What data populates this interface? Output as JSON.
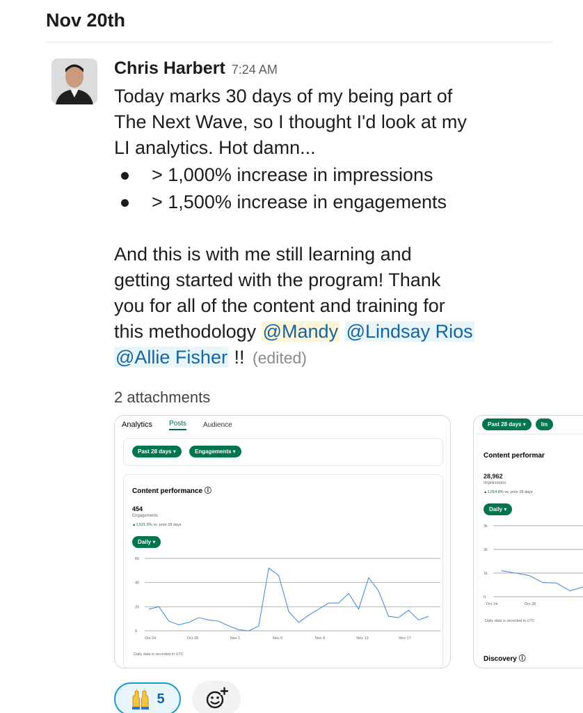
{
  "day_header": "Nov 20th",
  "message": {
    "author": "Chris Harbert",
    "time": "7:24 AM",
    "lines": [
      "Today marks 30 days of my being part of",
      "The Next Wave, so I thought I'd look at my",
      "LI analytics. Hot damn..."
    ],
    "bullets": [
      "> 1,000% increase in impressions",
      "> 1,500% increase in engagements"
    ],
    "para2_lines": [
      "And this is with me still learning and",
      "getting started with the program! Thank",
      "you for all of the content and training for"
    ],
    "last_line_prefix": "this methodology ",
    "mentions": [
      "@Mandy",
      "@Lindsay Rios",
      "@Allie Fisher"
    ],
    "suffix": " !!",
    "edited": "(edited)"
  },
  "attachments_label": "2 attachments",
  "attachment1": {
    "tabs": [
      "Analytics",
      "Posts",
      "Audience"
    ],
    "filters": [
      "Past 28 days ▾",
      "Engagements ▾"
    ],
    "title": "Content performance",
    "info_icon": "ⓘ",
    "value": "454",
    "metric": "Engagements",
    "delta_value": "▲1,521.5%",
    "delta_text": " vs. prior 28 days",
    "daily": "Daily ▾",
    "footnote": "Daily data is recorded in UTC"
  },
  "attachment2": {
    "filters": [
      "Past 28 days ▾",
      "Im"
    ],
    "title": "Content performar",
    "value": "28,962",
    "metric": "Impressions",
    "delta_value": "▲1,014.8%",
    "delta_text": " vs. prior 28 days",
    "daily": "Daily ▾",
    "footnote": "Daily data is recorded in UTC",
    "discovery": "Discovery"
  },
  "chart_data": [
    {
      "type": "line",
      "ylim": [
        0,
        60
      ],
      "yticks": [
        "0",
        "20",
        "40",
        "60"
      ],
      "xticks": [
        "Oct 24",
        "Oct 28",
        "Nov 1",
        "Nov 5",
        "Nov 9",
        "Nov 13",
        "Nov 17"
      ],
      "x": [
        "Oct 24",
        "Oct 25",
        "Oct 26",
        "Oct 27",
        "Oct 28",
        "Oct 29",
        "Oct 30",
        "Oct 31",
        "Nov 1",
        "Nov 2",
        "Nov 3",
        "Nov 4",
        "Nov 5",
        "Nov 6",
        "Nov 7",
        "Nov 8",
        "Nov 9",
        "Nov 10",
        "Nov 11",
        "Nov 12",
        "Nov 13",
        "Nov 14",
        "Nov 15",
        "Nov 16",
        "Nov 17",
        "Nov 18",
        "Nov 19"
      ],
      "values": [
        18,
        20,
        8,
        5,
        7,
        11,
        9,
        8,
        4,
        1,
        0,
        4,
        52,
        46,
        16,
        7,
        13,
        18,
        23,
        23,
        31,
        18,
        44,
        33,
        12,
        11,
        17,
        9,
        12
      ],
      "color": "#4a90d9"
    },
    {
      "type": "line",
      "ylim": [
        0,
        3000
      ],
      "yticks": [
        "0",
        "1k",
        "2k",
        "3k"
      ],
      "xticks": [
        "Oct 24",
        "Oct 28"
      ],
      "values": [
        1100,
        1000,
        900,
        600,
        580,
        250,
        420
      ],
      "color": "#4a90d9"
    }
  ],
  "reaction": {
    "emoji": "🙌",
    "count": "5"
  },
  "colors": {
    "mention": "#1264a3",
    "linkedin_green": "#01754f",
    "reaction_border": "#1d9bd1"
  }
}
